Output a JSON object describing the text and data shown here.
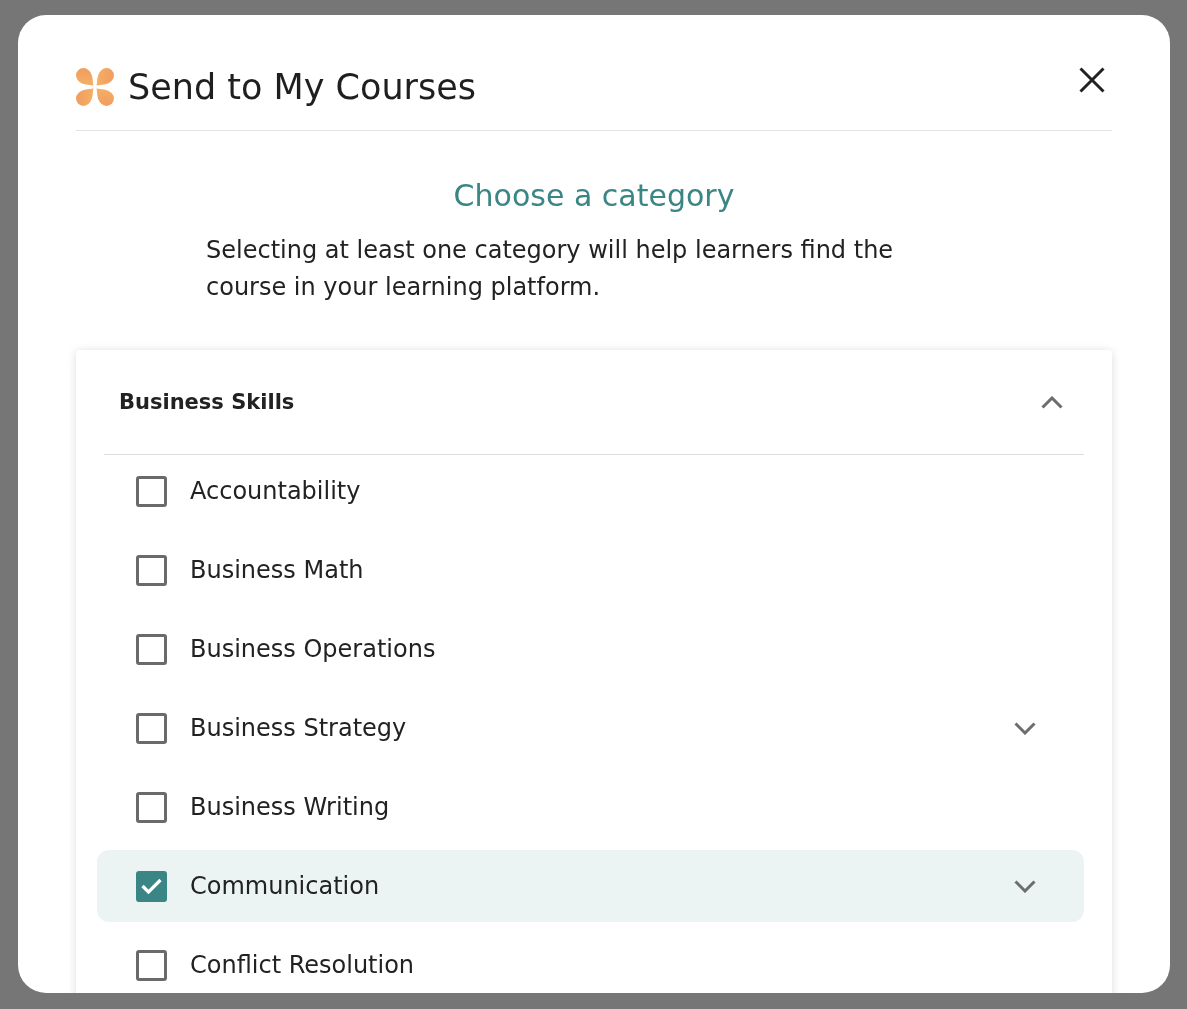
{
  "dialog": {
    "title": "Send to My Courses"
  },
  "intro": {
    "heading": "Choose a category",
    "text": "Selecting at least one category will help learners find the course in your learning platform."
  },
  "category_group": {
    "title": "Business Skills",
    "expanded": true,
    "items": [
      {
        "label": "Accountability",
        "kind": "leaf",
        "checked": false
      },
      {
        "label": "Business Math",
        "kind": "leaf",
        "checked": false
      },
      {
        "label": "Business Operations",
        "kind": "leaf",
        "checked": false
      },
      {
        "label": "Business Strategy",
        "kind": "parent",
        "expanded": false,
        "checked": false
      },
      {
        "label": "Business Writing",
        "kind": "leaf",
        "checked": false
      },
      {
        "label": "Communication",
        "kind": "parent",
        "expanded": false,
        "checked": true
      },
      {
        "label": "Conflict Resolution",
        "kind": "leaf",
        "checked": false
      }
    ]
  }
}
